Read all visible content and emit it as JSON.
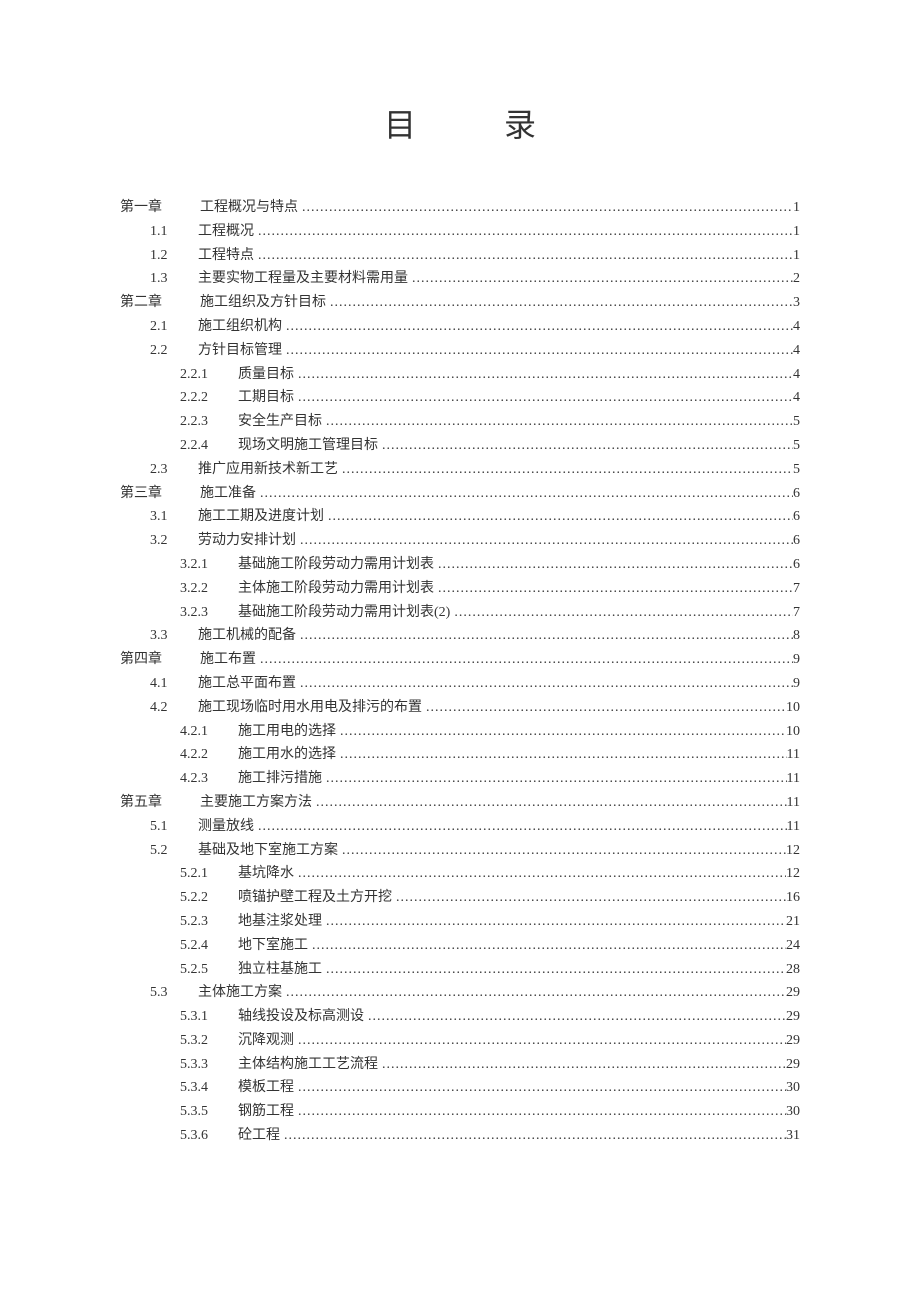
{
  "title": "目  录",
  "toc": [
    {
      "level": 1,
      "num": "第一章",
      "text": "工程概况与特点",
      "page": "1"
    },
    {
      "level": 2,
      "num": "1.1",
      "text": "工程概况",
      "page": "1"
    },
    {
      "level": 2,
      "num": "1.2",
      "text": "工程特点",
      "page": "1"
    },
    {
      "level": 2,
      "num": "1.3",
      "text": "主要实物工程量及主要材料需用量",
      "page": "2"
    },
    {
      "level": 1,
      "num": "第二章",
      "text": "施工组织及方针目标",
      "page": "3"
    },
    {
      "level": 2,
      "num": "2.1",
      "text": "施工组织机构",
      "page": "4"
    },
    {
      "level": 2,
      "num": "2.2",
      "text": "方针目标管理",
      "page": "4"
    },
    {
      "level": 3,
      "num": "2.2.1",
      "text": "质量目标",
      "page": "4"
    },
    {
      "level": 3,
      "num": "2.2.2",
      "text": "工期目标",
      "page": "4"
    },
    {
      "level": 3,
      "num": "2.2.3",
      "text": "安全生产目标",
      "page": "5"
    },
    {
      "level": 3,
      "num": "2.2.4",
      "text": "现场文明施工管理目标",
      "page": "5"
    },
    {
      "level": 2,
      "num": "2.3",
      "text": "推广应用新技术新工艺",
      "page": "5"
    },
    {
      "level": 1,
      "num": "第三章",
      "text": "施工准备",
      "page": "6"
    },
    {
      "level": 2,
      "num": "3.1",
      "text": "施工工期及进度计划",
      "page": "6"
    },
    {
      "level": 2,
      "num": "3.2",
      "text": "劳动力安排计划",
      "page": "6"
    },
    {
      "level": 3,
      "num": "3.2.1",
      "text": "基础施工阶段劳动力需用计划表",
      "page": "6"
    },
    {
      "level": 3,
      "num": "3.2.2",
      "text": "主体施工阶段劳动力需用计划表",
      "page": "7"
    },
    {
      "level": 3,
      "num": "3.2.3",
      "text": "基础施工阶段劳动力需用计划表(2)",
      "page": "7"
    },
    {
      "level": 2,
      "num": "3.3",
      "text": "施工机械的配备",
      "page": "8"
    },
    {
      "level": 1,
      "num": "第四章",
      "text": "施工布置",
      "page": "9"
    },
    {
      "level": 2,
      "num": "4.1",
      "text": "施工总平面布置",
      "page": "9"
    },
    {
      "level": 2,
      "num": "4.2",
      "text": "施工现场临时用水用电及排污的布置",
      "page": "10"
    },
    {
      "level": 3,
      "num": "4.2.1",
      "text": "施工用电的选择",
      "page": "10"
    },
    {
      "level": 3,
      "num": "4.2.2",
      "text": "施工用水的选择",
      "page": "11"
    },
    {
      "level": 3,
      "num": "4.2.3",
      "text": "施工排污措施",
      "page": "11"
    },
    {
      "level": 1,
      "num": "第五章",
      "text": "主要施工方案方法",
      "page": "11"
    },
    {
      "level": 2,
      "num": "5.1",
      "text": "测量放线",
      "page": "11"
    },
    {
      "level": 2,
      "num": "5.2",
      "text": "基础及地下室施工方案",
      "page": "12"
    },
    {
      "level": 3,
      "num": "5.2.1",
      "text": "基坑降水",
      "page": "12"
    },
    {
      "level": 3,
      "num": "5.2.2",
      "text": "喷锚护壁工程及土方开挖",
      "page": "16"
    },
    {
      "level": 3,
      "num": "5.2.3",
      "text": "地基注浆处理",
      "page": "21"
    },
    {
      "level": 3,
      "num": "5.2.4",
      "text": "地下室施工",
      "page": "24"
    },
    {
      "level": 3,
      "num": "5.2.5",
      "text": "独立柱基施工",
      "page": "28"
    },
    {
      "level": 2,
      "num": "5.3",
      "text": "主体施工方案",
      "page": "29"
    },
    {
      "level": 3,
      "num": "5.3.1",
      "text": "轴线投设及标高测设",
      "page": "29"
    },
    {
      "level": 3,
      "num": "5.3.2",
      "text": "沉降观测",
      "page": "29"
    },
    {
      "level": 3,
      "num": "5.3.3",
      "text": "主体结构施工工艺流程",
      "page": "29"
    },
    {
      "level": 3,
      "num": "5.3.4",
      "text": "模板工程",
      "page": "30"
    },
    {
      "level": 3,
      "num": "5.3.5",
      "text": "钢筋工程",
      "page": "30"
    },
    {
      "level": 3,
      "num": "5.3.6",
      "text": "砼工程",
      "page": "31"
    }
  ]
}
